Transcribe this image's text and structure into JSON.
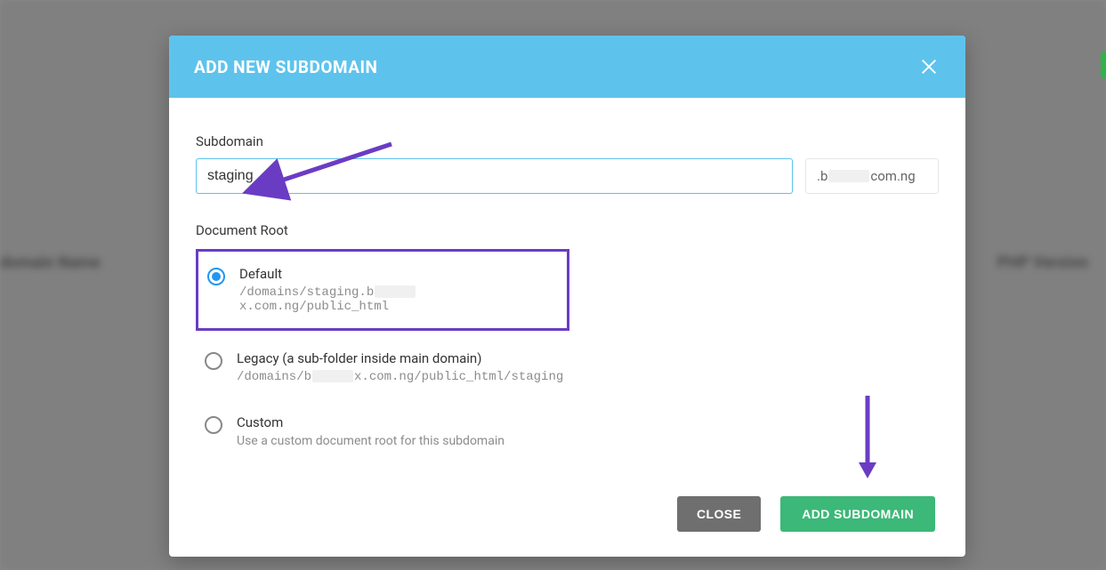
{
  "background": {
    "left_label": "domain Name",
    "right_label": "PHP Version"
  },
  "modal": {
    "title": "ADD NEW SUBDOMAIN",
    "subdomain_label": "Subdomain",
    "subdomain_value": "staging",
    "domain_suffix_prefix": ".b",
    "domain_suffix_suffix": "com.ng",
    "docroot_label": "Document Root",
    "options": {
      "default": {
        "title": "Default",
        "path_a": "/domains/staging.b",
        "path_b": "x.com.ng/public_html"
      },
      "legacy": {
        "title": "Legacy (a sub-folder inside main domain)",
        "path_a": "/domains/b",
        "path_b": "x.com.ng/public_html/staging"
      },
      "custom": {
        "title": "Custom",
        "desc": "Use a custom document root for this subdomain"
      }
    },
    "buttons": {
      "close": "CLOSE",
      "add": "ADD SUBDOMAIN"
    }
  },
  "colors": {
    "header": "#5ec3ec",
    "primary_btn": "#3cb878",
    "annotation": "#6a3cc4"
  }
}
